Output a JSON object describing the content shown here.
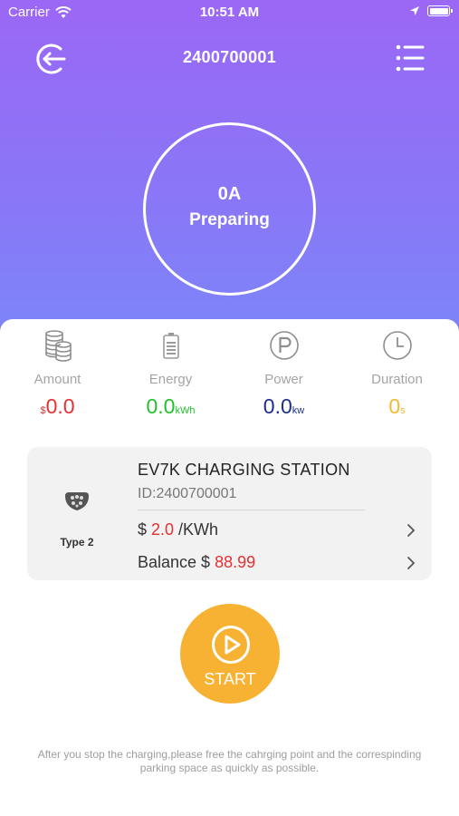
{
  "status_bar": {
    "carrier": "Carrier",
    "time": "10:51 AM"
  },
  "nav": {
    "title": "2400700001",
    "back_icon": "exit-icon",
    "menu_icon": "list-menu-icon"
  },
  "charger": {
    "current": "0A",
    "state": "Preparing"
  },
  "metrics": {
    "amount": {
      "label": "Amount",
      "unit": "$",
      "value": "0.0",
      "color": "#e83030",
      "icon": "coins-icon"
    },
    "energy": {
      "label": "Energy",
      "value": "0.0",
      "unit": "kWh",
      "color": "#22c22b",
      "icon": "battery-icon"
    },
    "power": {
      "label": "Power",
      "value": "0.0",
      "unit": "kw",
      "color": "#1d2e8a",
      "icon": "parking-icon"
    },
    "duration": {
      "label": "Duration",
      "value": "0",
      "unit": "s",
      "color": "#f1b932",
      "icon": "clock-icon"
    }
  },
  "station": {
    "connector_label": "Type 2",
    "name": "EV7K CHARGING STATION",
    "id": "ID:2400700001",
    "price_prefix": "$ ",
    "price": "2.0",
    "price_unit": " /KWh",
    "balance_prefix": "Balance $ ",
    "balance": "88.99"
  },
  "start_button": {
    "label": "START"
  },
  "note": "After you stop the charging,please free the cahrging point and the correspinding parking space as quickly as possible.",
  "colors": {
    "header_top": "#9b67f5",
    "header_bottom": "#7c86f8",
    "start": "#f8b233"
  }
}
